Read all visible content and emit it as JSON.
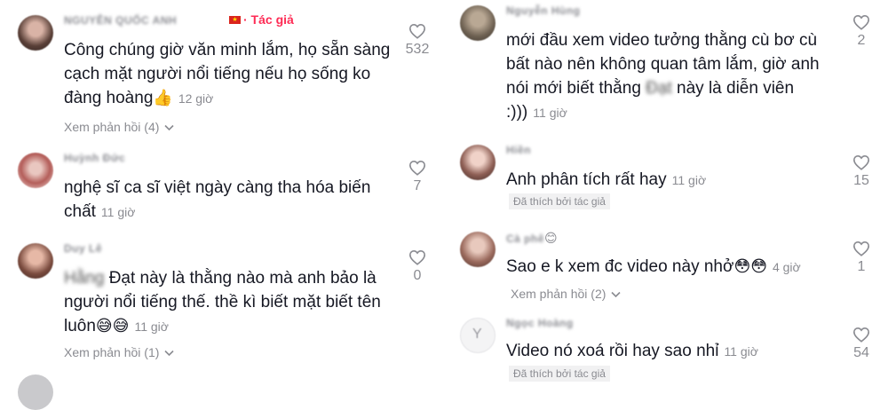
{
  "left_column": [
    {
      "username": "NGUYỄN QUỐC ANH",
      "flag_icon": "vietnam-flag-icon",
      "author_tag": "· Tác giả",
      "text": "Công chúng giờ văn minh lắm, họ sẵn sàng cạch mặt người nổi tiếng nếu họ sống ko đàng hoàng",
      "emoji": "👍",
      "time": "12 giờ",
      "likes": "532",
      "replies": "Xem phản hồi (4)"
    },
    {
      "username": "Huỳnh Đức",
      "text": "nghệ sĩ ca sĩ việt ngày càng tha hóa biến chất",
      "time": "11 giờ",
      "likes": "7"
    },
    {
      "username": "Duy Lê",
      "mention": "Hằng",
      "text": "Đạt này là thằng nào mà anh bảo là người nổi tiếng thế. thề kì biết mặt biết tên luôn",
      "emoji": "😅😅",
      "time": "11 giờ",
      "likes": "0",
      "replies": "Xem phản hồi (1)"
    }
  ],
  "right_column": [
    {
      "username": "Nguyễn Hùng",
      "text_a": "mới đầu xem video tưởng thằng cù bơ cù bất nào nên không quan tâm lắm, giờ anh nói mới biết thằng",
      "hidden_word": "Đạt",
      "text_b": "này là diễn viên :)))",
      "time": "11 giờ",
      "likes": "2"
    },
    {
      "username": "Hiền",
      "text": "Anh phân tích rất hay",
      "time": "11 giờ",
      "likes": "15",
      "liked_by": "Đã thích bởi tác giả"
    },
    {
      "username": "Cà phê",
      "username_emoji": "😊",
      "text": "Sao e k xem đc video này nhở",
      "emoji": "😳😳",
      "time": "4 giờ",
      "likes": "1",
      "replies": "Xem phản hồi (2)"
    },
    {
      "username": "Ngọc Hoàng",
      "text": "Video nó xoá rồi hay sao nhỉ",
      "time": "11 giờ",
      "likes": "54",
      "liked_by": "Đã thích bởi tác giả"
    }
  ],
  "icons": {
    "like": "heart-outline-icon",
    "replies": "chevron-down-icon"
  },
  "colors": {
    "author_tag": "#fe2c55",
    "meta_text": "#8a8b91",
    "body_text": "#161823",
    "liked_chip_bg": "#f1f1f2"
  }
}
